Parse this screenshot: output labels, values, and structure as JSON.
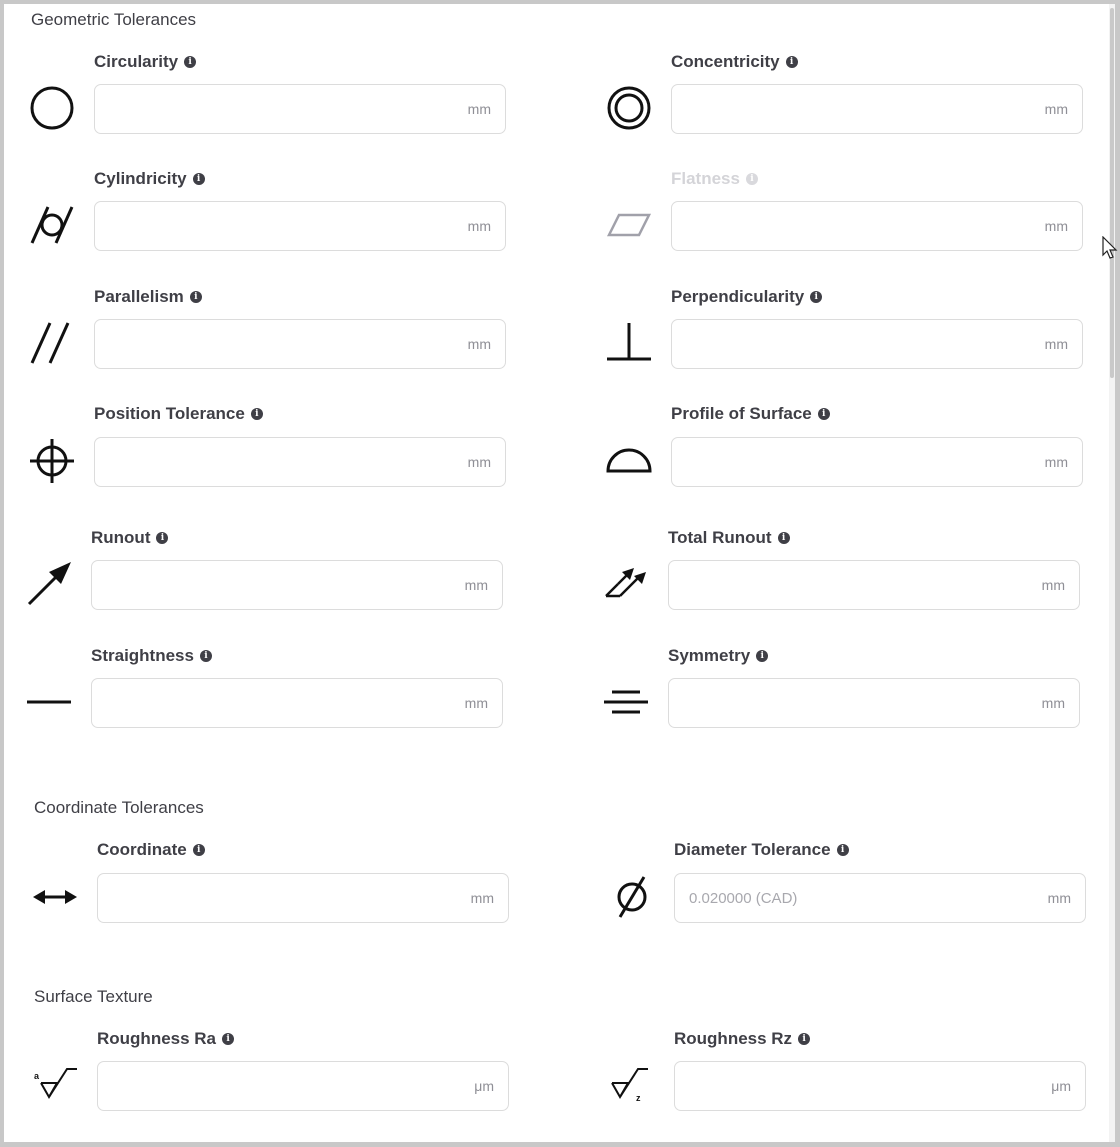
{
  "sections": {
    "geometric": "Geometric Tolerances",
    "coordinate": "Coordinate Tolerances",
    "surface": "Surface Texture"
  },
  "fields": {
    "circularity": {
      "label": "Circularity",
      "unit": "mm",
      "value": "",
      "placeholder": "",
      "icon": "circle-icon"
    },
    "concentricity": {
      "label": "Concentricity",
      "unit": "mm",
      "value": "",
      "placeholder": "",
      "icon": "concentric-circles-icon"
    },
    "cylindricity": {
      "label": "Cylindricity",
      "unit": "mm",
      "value": "",
      "placeholder": "",
      "icon": "cylindricity-icon"
    },
    "flatness": {
      "label": "Flatness",
      "unit": "mm",
      "value": "",
      "placeholder": "",
      "icon": "parallelogram-icon",
      "disabled": true
    },
    "parallelism": {
      "label": "Parallelism",
      "unit": "mm",
      "value": "",
      "placeholder": "",
      "icon": "parallel-lines-icon"
    },
    "perpendicularity": {
      "label": "Perpendicularity",
      "unit": "mm",
      "value": "",
      "placeholder": "",
      "icon": "perpendicular-icon"
    },
    "position": {
      "label": "Position Tolerance",
      "unit": "mm",
      "value": "",
      "placeholder": "",
      "icon": "crosshair-icon"
    },
    "profile_surface": {
      "label": "Profile of Surface",
      "unit": "mm",
      "value": "",
      "placeholder": "",
      "icon": "semicircle-icon"
    },
    "runout": {
      "label": "Runout",
      "unit": "mm",
      "value": "",
      "placeholder": "",
      "icon": "arrow-icon"
    },
    "total_runout": {
      "label": "Total Runout",
      "unit": "mm",
      "value": "",
      "placeholder": "",
      "icon": "double-arrow-icon"
    },
    "straightness": {
      "label": "Straightness",
      "unit": "mm",
      "value": "",
      "placeholder": "",
      "icon": "line-icon"
    },
    "symmetry": {
      "label": "Symmetry",
      "unit": "mm",
      "value": "",
      "placeholder": "",
      "icon": "symmetry-icon"
    },
    "coordinate": {
      "label": "Coordinate",
      "unit": "mm",
      "value": "",
      "placeholder": "",
      "icon": "double-headed-arrow-icon"
    },
    "diameter": {
      "label": "Diameter Tolerance",
      "unit": "mm",
      "value": "",
      "placeholder": "0.020000 (CAD)",
      "icon": "diameter-icon"
    },
    "roughness_ra": {
      "label": "Roughness Ra",
      "unit": "μm",
      "value": "",
      "placeholder": "",
      "icon": "roughness-ra-icon",
      "icon_letter": "a"
    },
    "roughness_rz": {
      "label": "Roughness Rz",
      "unit": "μm",
      "value": "",
      "placeholder": "",
      "icon": "roughness-rz-icon",
      "icon_letter": "z"
    }
  },
  "info_glyph": "i"
}
